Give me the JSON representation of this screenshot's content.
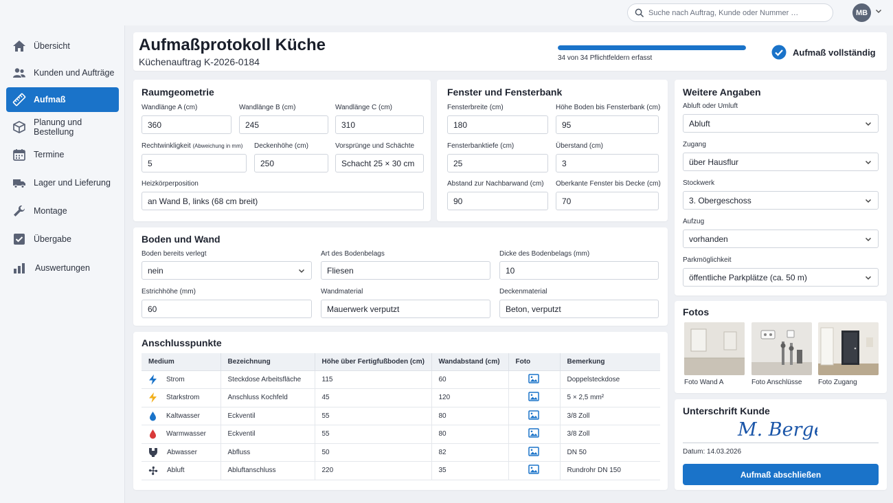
{
  "search": {
    "placeholder": "Suche nach Auftrag, Kunde oder Nummer …"
  },
  "user": {
    "initials": "MB"
  },
  "nav": [
    {
      "label": "Übersicht",
      "icon": "home-icon"
    },
    {
      "label": "Kunden und Aufträge",
      "icon": "users-icon"
    },
    {
      "label": "Aufmaß",
      "icon": "ruler-icon",
      "active": true
    },
    {
      "label": "Planung und Bestellung",
      "icon": "box-icon"
    },
    {
      "label": "Termine",
      "icon": "calendar-icon"
    },
    {
      "label": "Lager und Lieferung",
      "icon": "truck-icon"
    },
    {
      "label": "Montage",
      "icon": "wrench-icon"
    },
    {
      "label": "Übergabe",
      "icon": "checkbox-icon"
    },
    {
      "label": "Auswertungen",
      "icon": "bar-chart-icon"
    }
  ],
  "header": {
    "title": "Aufmaßprotokoll Küche",
    "subtitle": "Küchenauftrag K-2026-0184",
    "progress_done": 34,
    "progress_total": 34,
    "progress_text": "34 von 34 Pflichtfeldern erfasst",
    "status": "Aufmaß vollständig"
  },
  "raumgeometrie": {
    "title": "Raumgeometrie",
    "wall_a_label": "Wandlänge A (cm)",
    "wall_a": "360",
    "wall_b_label": "Wandlänge B (cm)",
    "wall_b": "245",
    "wall_c_label": "Wandlänge C (cm)",
    "wall_c": "310",
    "square_label": "Rechtwinkligkeit",
    "square_hint": "(Abweichung in mm)",
    "square": "5",
    "ceiling_label": "Deckenhöhe (cm)",
    "ceiling": "250",
    "protrusion_label": "Vorsprünge und Schächte",
    "protrusion": "Schacht 25 × 30 cm",
    "radiator_label": "Heizkörperposition",
    "radiator": "an Wand B, links (68 cm breit)"
  },
  "fenster": {
    "title": "Fenster und Fensterbank",
    "width_label": "Fensterbreite (cm)",
    "width": "180",
    "sill_height_label": "Höhe Boden bis Fensterbank (cm)",
    "sill_height": "95",
    "sill_depth_label": "Fensterbanktiefe (cm)",
    "sill_depth": "25",
    "overhang_label": "Überstand (cm)",
    "overhang": "3",
    "wall_dist_label": "Abstand zur Nachbarwand (cm)",
    "wall_dist": "90",
    "top_label": "Oberkante Fenster bis Decke (cm)",
    "top": "70"
  },
  "boden": {
    "title": "Boden und Wand",
    "laid_label": "Boden bereits verlegt",
    "laid": "nein",
    "floor_type_label": "Art des Bodenbelags",
    "floor_type": "Fliesen",
    "floor_thick_label": "Dicke des Bodenbelags (mm)",
    "floor_thick": "10",
    "screed_label": "Estrichhöhe (mm)",
    "screed": "60",
    "wall_mat_label": "Wandmaterial",
    "wall_mat": "Mauerwerk verputzt",
    "ceiling_mat_label": "Deckenmaterial",
    "ceiling_mat": "Beton, verputzt"
  },
  "weitere": {
    "title": "Weitere Angaben",
    "exhaust_label": "Abluft oder Umluft",
    "exhaust": "Abluft",
    "access_label": "Zugang",
    "access": "über Hausflur",
    "floor_label": "Stockwerk",
    "floor": "3. Obergeschoss",
    "lift_label": "Aufzug",
    "lift": "vorhanden",
    "parking_label": "Parkmöglichkeit",
    "parking": "öffentliche Parkplätze (ca. 50 m)"
  },
  "anschluss": {
    "title": "Anschlusspunkte",
    "columns": [
      "Medium",
      "Bezeichnung",
      "Höhe über Fertigfußboden (cm)",
      "Wandabstand (cm)",
      "Foto",
      "Bemerkung"
    ],
    "rows": [
      {
        "icon": "lightning-icon",
        "color": "#1a73c9",
        "medium": "Strom",
        "name": "Steckdose Arbeitsfläche",
        "height": "115",
        "dist": "60",
        "note": "Doppelsteckdose"
      },
      {
        "icon": "lightning-icon",
        "color": "#f2b01e",
        "medium": "Starkstrom",
        "name": "Anschluss Kochfeld",
        "height": "45",
        "dist": "120",
        "note": "5 × 2,5 mm²"
      },
      {
        "icon": "drop-icon",
        "color": "#1a73c9",
        "medium": "Kaltwasser",
        "name": "Eckventil",
        "height": "55",
        "dist": "80",
        "note": "3/8 Zoll"
      },
      {
        "icon": "drop-icon",
        "color": "#d93a3a",
        "medium": "Warmwasser",
        "name": "Eckventil",
        "height": "55",
        "dist": "80",
        "note": "3/8 Zoll"
      },
      {
        "icon": "drain-icon",
        "color": "#3a4152",
        "medium": "Abwasser",
        "name": "Abfluss",
        "height": "50",
        "dist": "82",
        "note": "DN 50"
      },
      {
        "icon": "fan-icon",
        "color": "#3a4152",
        "medium": "Abluft",
        "name": "Abluftanschluss",
        "height": "220",
        "dist": "35",
        "note": "Rundrohr DN 150"
      }
    ]
  },
  "fotos": {
    "title": "Fotos",
    "items": [
      {
        "caption": "Foto Wand A"
      },
      {
        "caption": "Foto Anschlüsse"
      },
      {
        "caption": "Foto Zugang"
      }
    ]
  },
  "unterschrift": {
    "title": "Unterschrift Kunde",
    "signature": "M. Berger",
    "date": "Datum: 14.03.2026",
    "button": "Aufmaß abschließen"
  },
  "colors": {
    "accent": "#1a73c9",
    "background": "#eef0f4"
  }
}
